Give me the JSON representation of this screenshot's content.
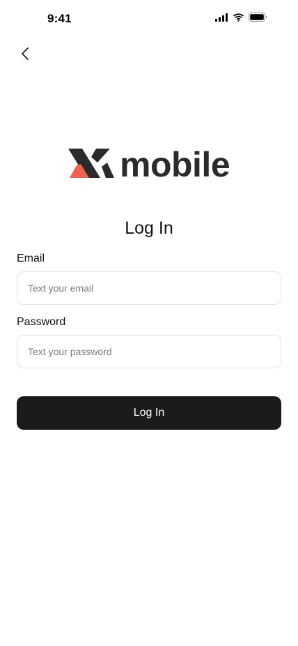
{
  "status_bar": {
    "time": "9:41",
    "icons": [
      "cellular-signal-icon",
      "wifi-icon",
      "battery-icon"
    ]
  },
  "nav": {
    "back_icon": "chevron-left-icon"
  },
  "logo": {
    "wordmark": "mobile",
    "colors": {
      "dark": "#2b2b2b",
      "accent": "#f0604a"
    }
  },
  "form": {
    "title": "Log In",
    "email": {
      "label": "Email",
      "value": "",
      "placeholder": "Text your email"
    },
    "password": {
      "label": "Password",
      "value": "",
      "placeholder": "Text your password"
    },
    "submit_label": "Log In"
  },
  "colors": {
    "background": "#ffffff",
    "button_bg": "#1b1b1b",
    "button_text": "#ffffff",
    "input_border": "#e2e2e2"
  }
}
